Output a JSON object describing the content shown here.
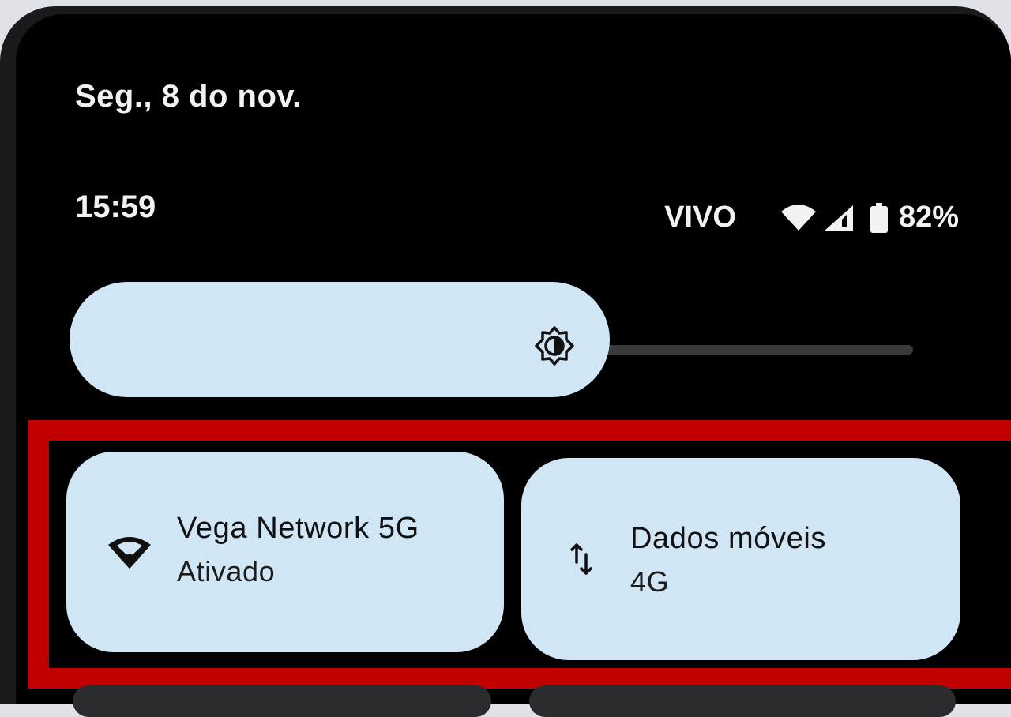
{
  "header": {
    "date": "Seg., 8 do nov.",
    "time": "15:59",
    "carrier": "VIVO",
    "battery_percent": "82%"
  },
  "status_icons": [
    "wifi-icon",
    "cell-signal-icon",
    "battery-icon"
  ],
  "brightness": {
    "level": 0.64,
    "icon": "brightness-icon"
  },
  "tiles": [
    {
      "title": "Vega Network 5G",
      "subtitle": "Ativado",
      "icon": "wifi-icon"
    },
    {
      "title": "Dados móveis",
      "subtitle": "4G",
      "icon": "mobile-data-icon"
    }
  ],
  "colors": {
    "tile_bg": "#d1e6f5",
    "highlight": "#c20000",
    "background": "#000000"
  }
}
